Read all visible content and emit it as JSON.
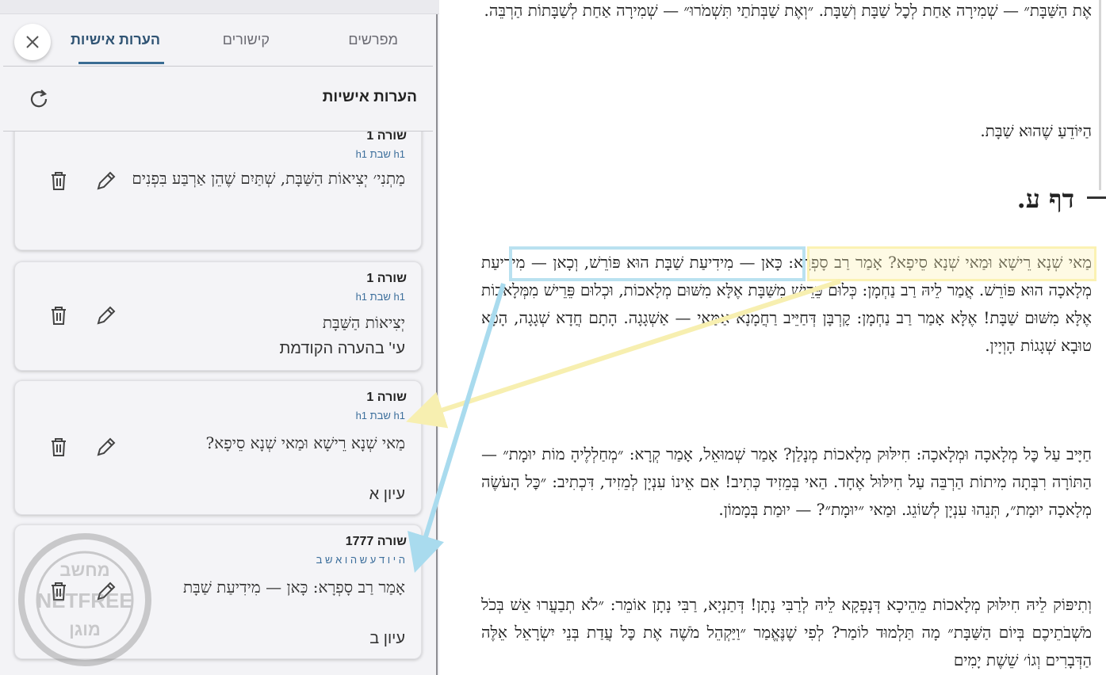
{
  "tabs": [
    {
      "label": "מפרשים"
    },
    {
      "label": "קישורים"
    },
    {
      "label": "הערות אישיות"
    }
  ],
  "header": {
    "title": "הערות אישיות"
  },
  "cards": [
    {
      "line": "שורה 1",
      "ref": "h1 שבת h1",
      "text": "מַתְנִי׳ יְצִיאוֹת הַשַּׁבָּת, שְׁתַּיִם שֶׁהֵן אַרְבַּע בִּפְנִים",
      "note": ""
    },
    {
      "line": "שורה 1",
      "ref": "h1 שבת h1",
      "text": "יְצִיאוֹת הַשַּׁבָּת",
      "note": "עי' בהערה הקודמת"
    },
    {
      "line": "שורה 1",
      "ref": "h1 שבת h1",
      "text": "מַאי שְׁנָא רֵישָׁא וּמַאי שְׁנָא סֵיפָא?",
      "note": "עיון א"
    },
    {
      "line": "שורה 1777",
      "ref": "ה י ו ד ע ש ה ו א ש ב",
      "text": "אָמַר רַב סָפְרָא: כָּאן — מִידִיעַת שַׁבָּת",
      "note": "עיון ב"
    }
  ],
  "watermark": {
    "top": "מחשב",
    "middle": "NETFREE",
    "bottom": "מוגן"
  },
  "content": {
    "para0_top": "אֶת הַשַּׁבָּת״ — שְׁמִירָה אַחַת לְכׇל שַׁבָּת וְשַׁבָּת. ״וְאֶת שַׁבְּתֹתַי תִּשְׁמֹרוּ״ — שְׁמִירָה אַחַת לְשַׁבָּתוֹת הַרְבֵּה.",
    "para0_end": "הַיּוֹדֵעַ שֶׁהוּא שַׁבָּת.",
    "daf_title": "דף ע.",
    "para1": "מַאי שְׁנָא רֵישָׁא וּמַאי שְׁנָא סֵיפָא? אָמַר רַב סָפְרָא: כָּאן — מִידִיעַת שַׁבָּת הוּא פּוֹרֵשׁ, וְכָאן — מִידִיעַת מְלָאכָה הוּא פּוֹרֵשׁ. אֲמַר לֵיהּ רַב נַחְמָן: כְּלוּם פֵּרֵישׁ מִשַּׁבָּת אֶלָּא מִשּׁוּם מְלָאכוֹת, וּכְלוּם פֵּרֵישׁ מִמְּלָאכוֹת אֶלָּא מִשּׁוּם שַׁבָּת! אֶלָּא אָמַר רַב נַחְמָן: קׇרְבָּן דְּחַיֵּיב רַחֲמָנָא אַמַּאי — אַשְׁגָגָה. הָתָם חֲדָא שְׁגָגָה, הָכָא טוּבָא שְׁגָגוֹת הָוְיָין.",
    "para2": "חַיָּיב עַל כׇּל מְלָאכָה וּמְלָאכָה: חִילּוּק מְלָאכוֹת מְנָלַן? אָמַר שְׁמוּאֵל, אָמַר קְרָא: ״מְחַלְלֶיהָ מוֹת יוּמָת״ — הַתּוֹרָה רִבְּתָה מִיתוֹת הַרְבֵּה עַל חִילּוּל אֶחָד. הַאי בְּמֵזִיד כְּתִיב! אִם אֵינוֹ עִנְיָן לְמֵזִיד, דִּכְתִיב: ״כׇּל הָעֹשֶׂה מְלָאכָה יוּמָת״, תְּנֵהוּ עִנְיָן לְשׁוֹגֵג. וּמַאי ״יוּמָת״? — יוּמַת בְּמָמוֹן.",
    "para3": "וְתִיפּוֹק לֵיהּ חִילּוּק מְלָאכוֹת מֵהֵיכָא דְּנָפְקָא לֵיהּ לְרַבִּי נָתָן! דְּתַנְיָא, רַבִּי נָתָן אוֹמֵר: ״לֹא תְבַעֲרוּ אֵשׁ בְּכֹל מֹשְׁבֹתֵיכֶם בְּיוֹם הַשַּׁבָּת״ מָה תַּלְמוּד לוֹמַר? לְפִי שֶׁנֶּאֱמַר ״וַיַּקְהֵל מֹשֶׁה אֶת כׇּל עֲדַת בְּנֵי יִשְׂרָאֵל אֵלֶּה הַדְּבָרִים וְגוֹ׳ שֵׁשֶׁת יָמִים"
  },
  "colors": {
    "accent": "#3a6c93",
    "highlight_yellow": "#fbf2b3",
    "highlight_blue": "#b9e1f0"
  }
}
